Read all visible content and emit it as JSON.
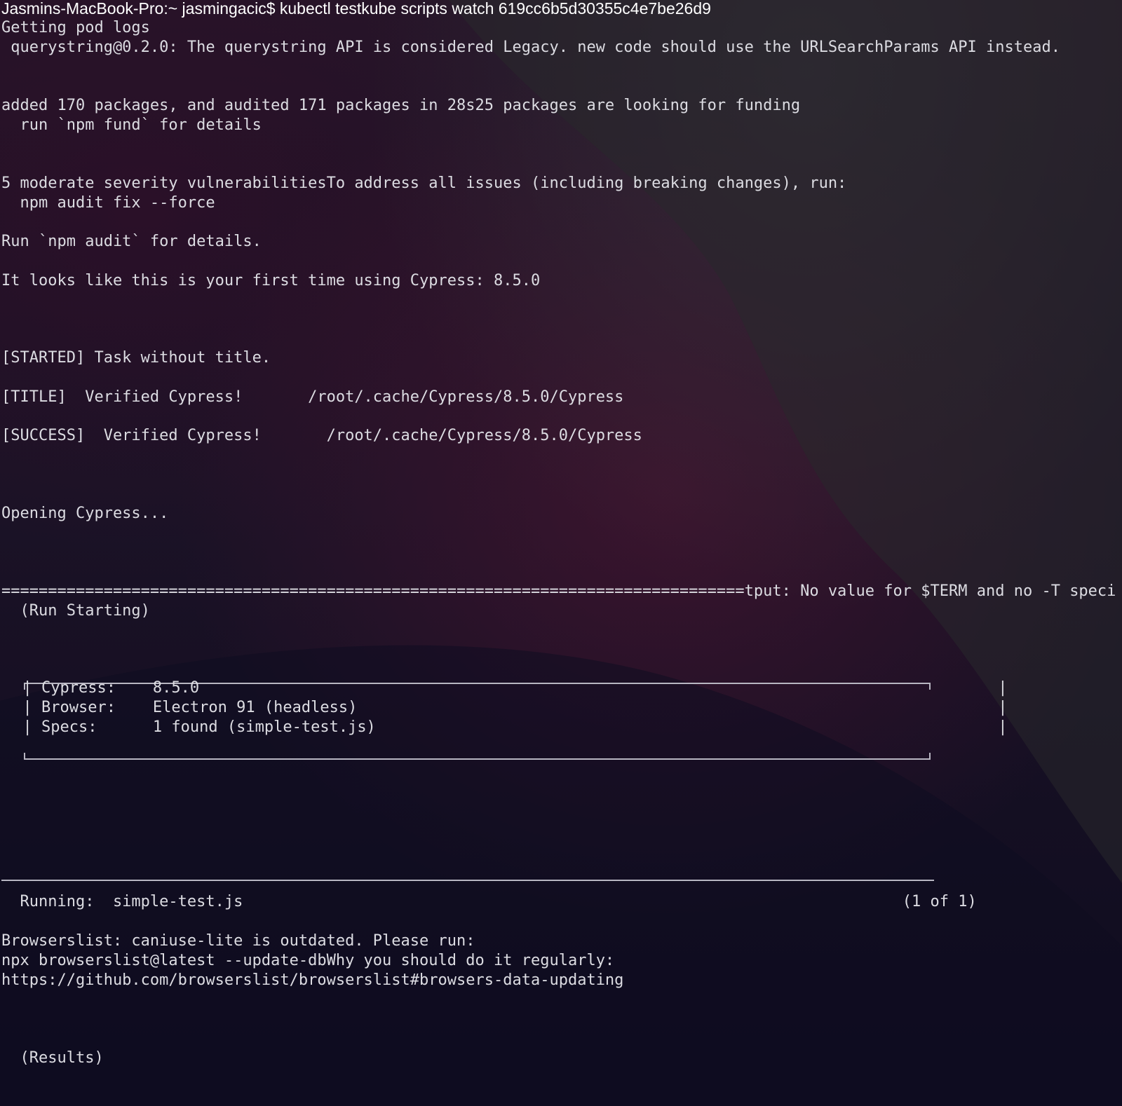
{
  "terminal": {
    "prompt": "Jasmins-MacBook-Pro:~ jasmingacic$ kubectl testkube scripts watch 619cc6b5d30355c4e7be26d9",
    "lines": {
      "getting_logs": "Getting pod logs",
      "querystring": " querystring@0.2.0: The querystring API is considered Legacy. new code should use the URLSearchParams API instead.",
      "added_packages": "added 170 packages, and audited 171 packages in 28s25 packages are looking for funding",
      "npm_fund": "  run `npm fund` for details",
      "vulnerabilities": "5 moderate severity vulnerabilitiesTo address all issues (including breaking changes), run:",
      "audit_fix": "  npm audit fix --force",
      "run_audit": "Run `npm audit` for details.",
      "first_time": "It looks like this is your first time using Cypress: 8.5.0",
      "started": "[STARTED] Task without title.",
      "title": "[TITLE]  Verified Cypress!       /root/.cache/Cypress/8.5.0/Cypress",
      "success": "[SUCCESS]  Verified Cypress!       /root/.cache/Cypress/8.5.0/Cypress",
      "opening": "Opening Cypress...",
      "tput": "================================================================================tput: No value for $TERM and no -T speci",
      "run_starting": "  (Run Starting)",
      "box_cypress": "  | Cypress:    8.5.0                                                                                      |",
      "box_browser": "  | Browser:    Electron 91 (headless)                                                                     |",
      "box_specs": "  | Specs:      1 found (simple-test.js)                                                                   |",
      "running": "  Running:  simple-test.js                                                                       (1 of 1)",
      "browserslist": "Browserslist: caniuse-lite is outdated. Please run:",
      "npx": "npx browserslist@latest --update-dbWhy you should do it regularly:",
      "url": "https://github.com/browserslist/browserslist#browsers-data-updating",
      "results": "  (Results)"
    }
  }
}
